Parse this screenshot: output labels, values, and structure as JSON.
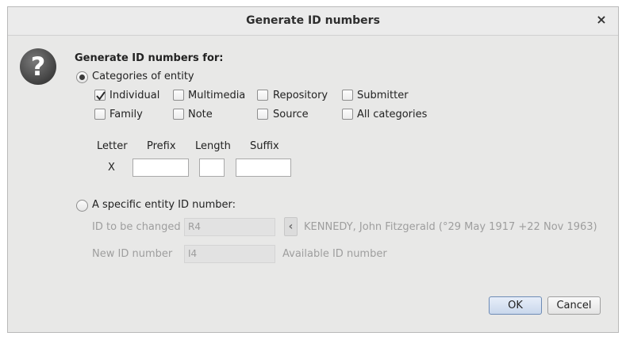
{
  "window": {
    "title": "Generate ID numbers",
    "close_symbol": "×"
  },
  "icons": {
    "help": "question-mark-icon",
    "close": "close-icon",
    "nav": "chevron-left-icon"
  },
  "form": {
    "heading": "Generate ID numbers for:",
    "mode_categories": {
      "label": "Categories of entity",
      "selected": true
    },
    "categories": [
      {
        "label": "Individual",
        "checked": true
      },
      {
        "label": "Multimedia",
        "checked": false
      },
      {
        "label": "Repository",
        "checked": false
      },
      {
        "label": "Submitter",
        "checked": false
      },
      {
        "label": "Family",
        "checked": false
      },
      {
        "label": "Note",
        "checked": false
      },
      {
        "label": "Source",
        "checked": false
      },
      {
        "label": "All categories",
        "checked": false
      }
    ],
    "columns": {
      "letter": "Letter",
      "prefix": "Prefix",
      "length": "Length",
      "suffix": "Suffix"
    },
    "letter_value": "X",
    "prefix_value": "",
    "length_value": "",
    "suffix_value": "",
    "mode_specific": {
      "label": "A specific entity ID number:",
      "selected": false
    },
    "id_to_change": {
      "label": "ID to be changed",
      "value": "R4"
    },
    "entity_name": "KENNEDY, John Fitzgerald (°29 May 1917 +22 Nov 1963)",
    "new_id": {
      "label": "New ID number",
      "value": "I4"
    },
    "available_text": "Available ID number"
  },
  "buttons": {
    "ok": "OK",
    "cancel": "Cancel"
  }
}
